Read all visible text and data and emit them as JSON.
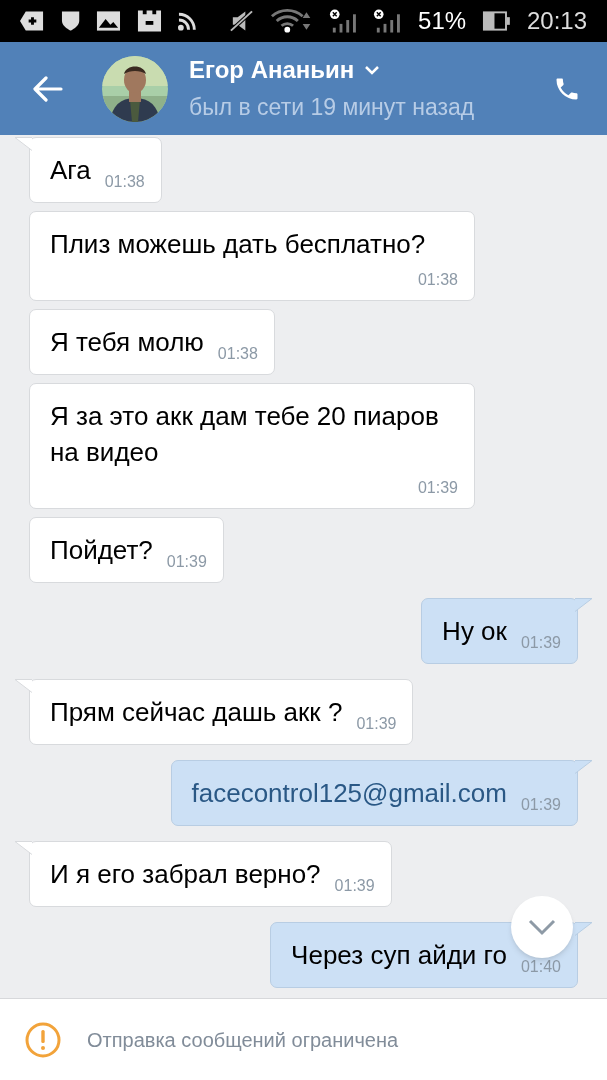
{
  "status_bar": {
    "battery": "51%",
    "time": "20:13"
  },
  "header": {
    "name": "Егор Ананьин",
    "presence": "был в сети 19 минут назад"
  },
  "messages": [
    {
      "outgoing": false,
      "tail": true,
      "link": false,
      "text": "Ага",
      "time": "01:38"
    },
    {
      "outgoing": false,
      "tail": false,
      "link": false,
      "text": "Плиз можешь дать бесплатно?",
      "time": "01:38"
    },
    {
      "outgoing": false,
      "tail": false,
      "link": false,
      "text": "Я тебя молю",
      "time": "01:38"
    },
    {
      "outgoing": false,
      "tail": false,
      "link": false,
      "text": "Я за это акк дам тебе 20 пиаров на видео",
      "time": "01:39"
    },
    {
      "outgoing": false,
      "tail": false,
      "link": false,
      "text": "Пойдет?",
      "time": "01:39"
    },
    {
      "outgoing": true,
      "tail": true,
      "link": false,
      "text": "Ну ок",
      "time": "01:39"
    },
    {
      "outgoing": false,
      "tail": true,
      "link": false,
      "text": "Прям сейчас дашь акк ?",
      "time": "01:39"
    },
    {
      "outgoing": true,
      "tail": true,
      "link": true,
      "text": "facecontrol125@gmail.com",
      "time": "01:39"
    },
    {
      "outgoing": false,
      "tail": true,
      "link": false,
      "text": "И я его забрал верно?",
      "time": "01:39"
    },
    {
      "outgoing": true,
      "tail": true,
      "link": false,
      "text": "Через суп айди го",
      "time": "01:40"
    }
  ],
  "notice": "Отправка сообщений ограничена"
}
